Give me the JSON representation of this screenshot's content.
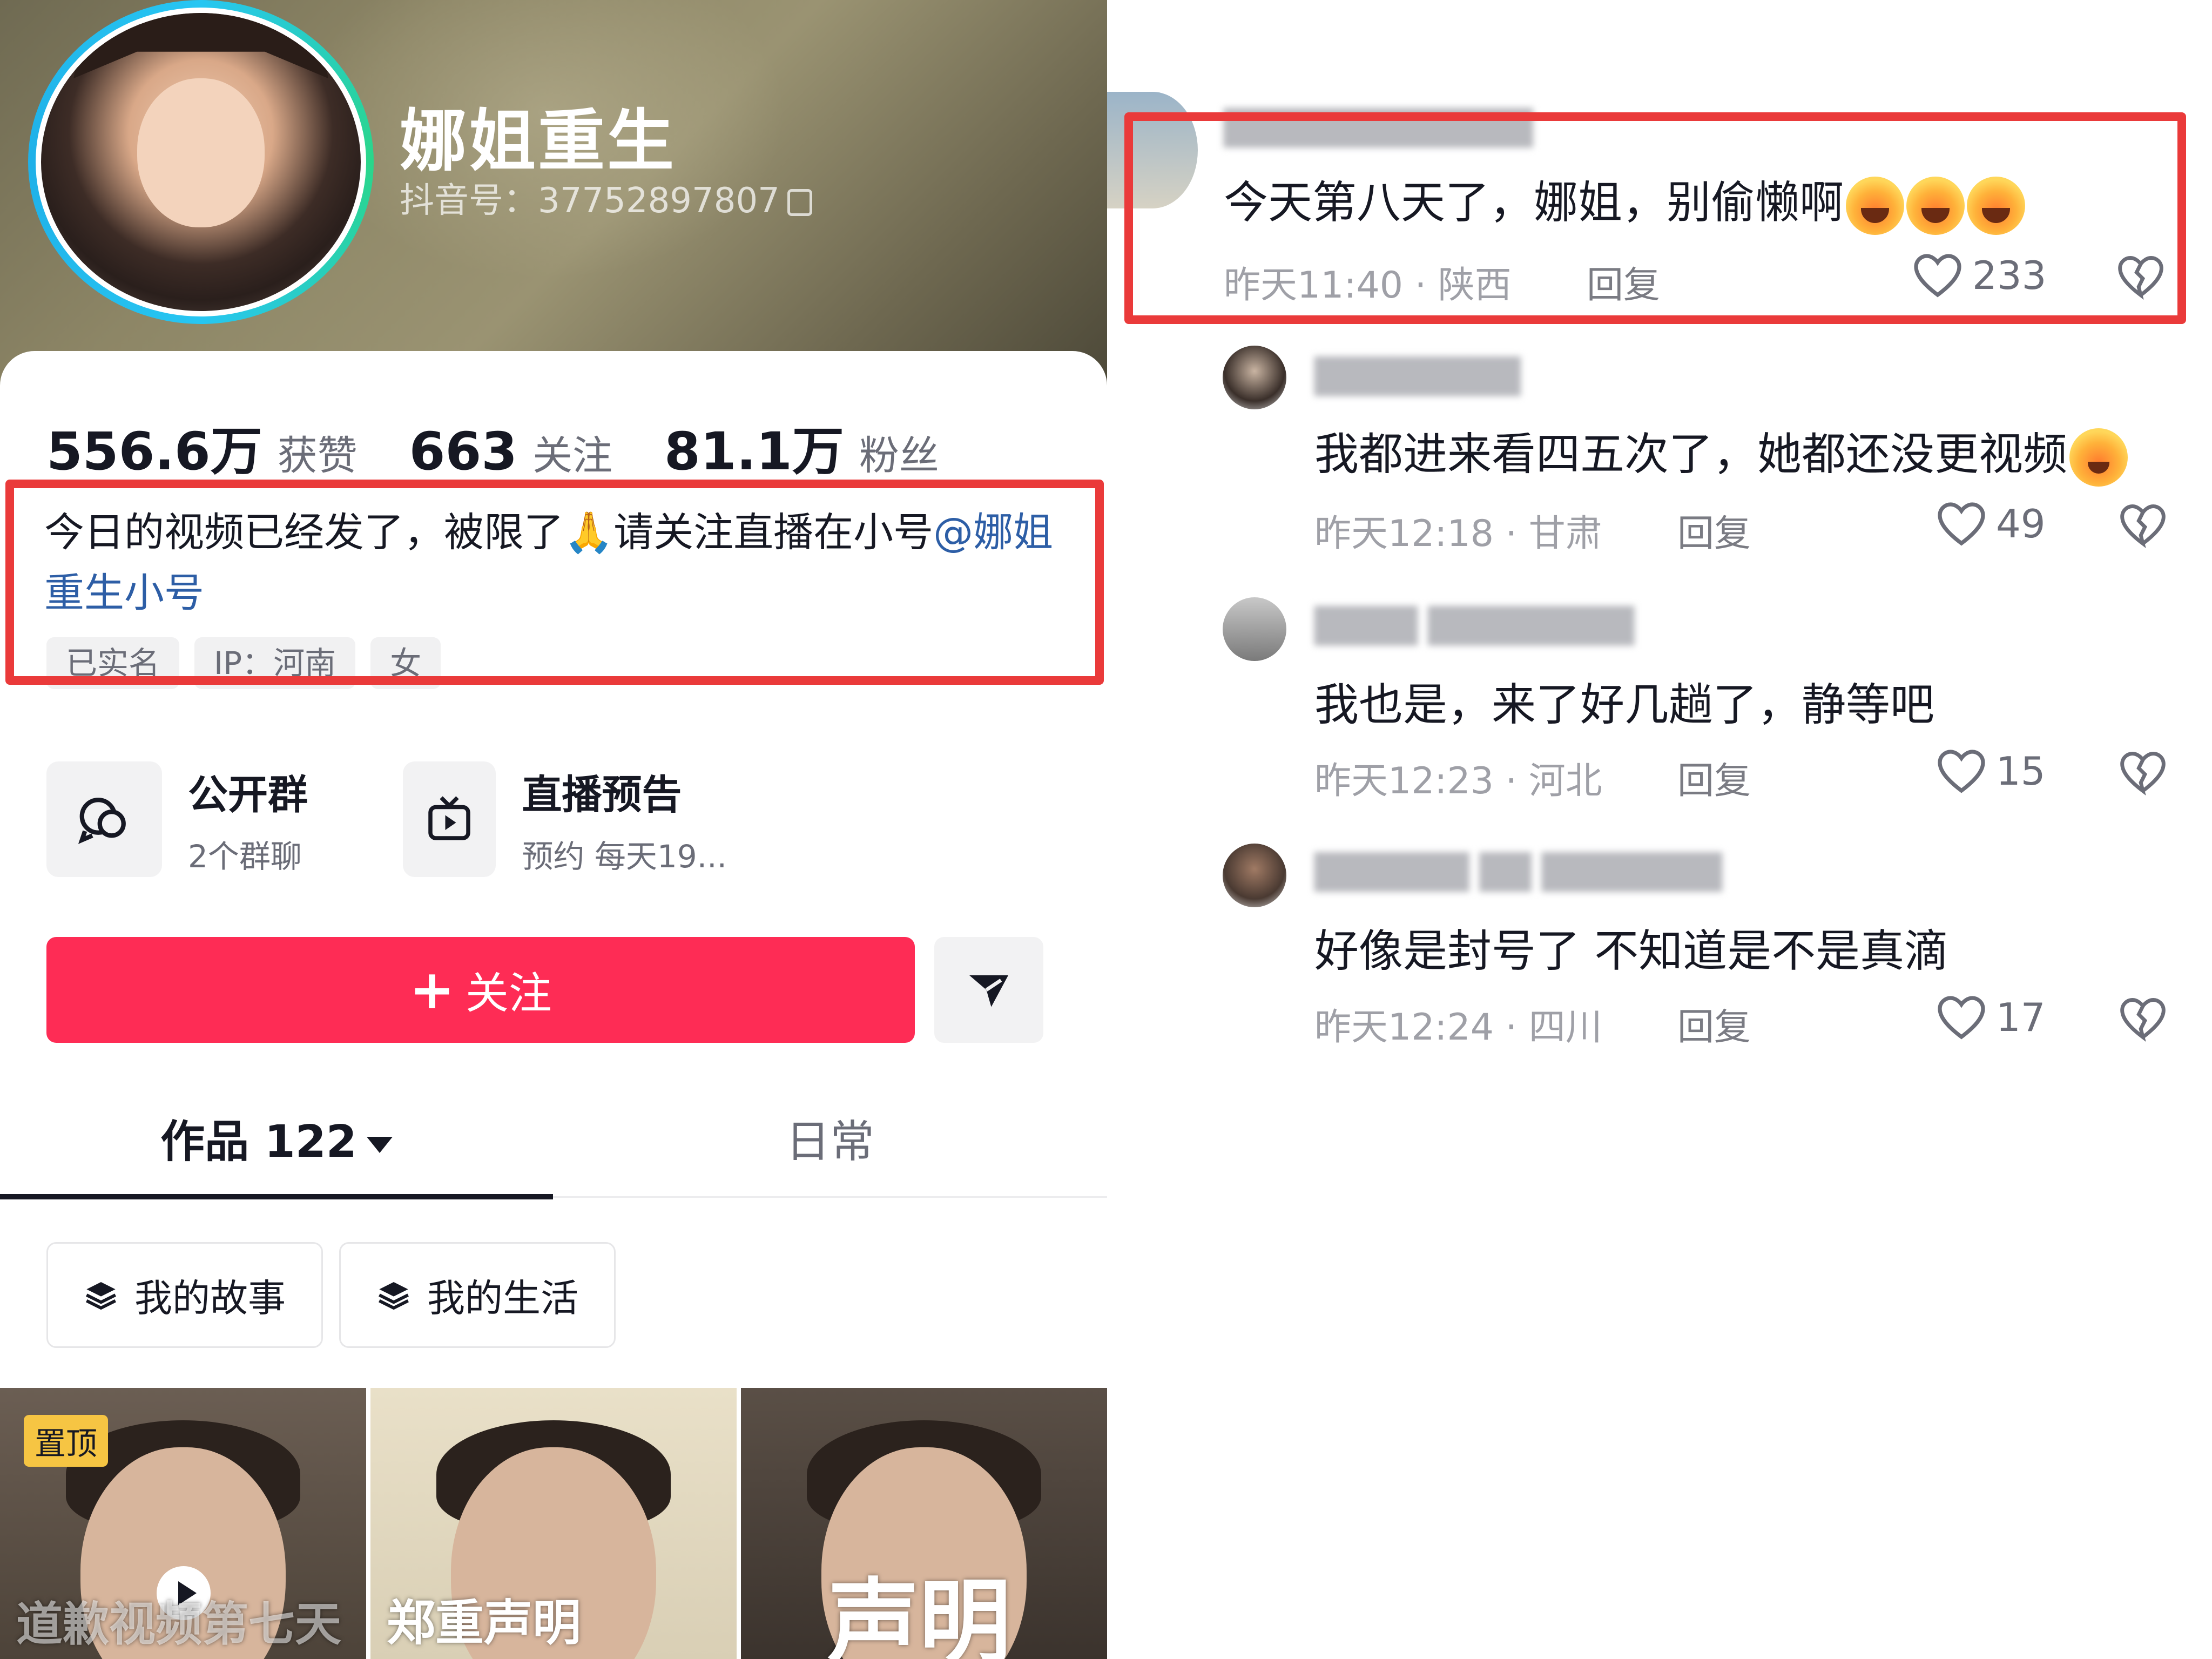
{
  "profile": {
    "nickname": "娜姐重生",
    "douyin_id": "抖音号：37752897807",
    "stats": [
      {
        "value": "556.6万",
        "label": "获赞"
      },
      {
        "value": "663",
        "label": "关注"
      },
      {
        "value": "81.1万",
        "label": "粉丝"
      }
    ],
    "bio_text": "今日的视频已经发了，被限了🙏请关注直播在小号",
    "bio_mention": "@娜姐重生小号",
    "tags": [
      "已实名",
      "IP：河南",
      "女"
    ],
    "shortcuts": [
      {
        "title": "公开群",
        "subtitle": "2个群聊",
        "icon": "group-chat-icon"
      },
      {
        "title": "直播预告",
        "subtitle": "预约 每天19...",
        "icon": "live-tv-icon"
      }
    ],
    "follow_label": "关注",
    "tabs": [
      {
        "label": "作品 122"
      },
      {
        "label": "日常"
      }
    ],
    "collections": [
      {
        "label": "我的故事",
        "icon": "stack-icon"
      },
      {
        "label": "我的生活",
        "icon": "stack-icon"
      }
    ],
    "videos": [
      {
        "badge": "置顶",
        "caption": "道歉视频第七天"
      },
      {
        "caption": "郑重声明"
      },
      {
        "caption": "声明"
      }
    ],
    "colors": {
      "follow": "#fe2c55",
      "highlight": "#ea3a3a",
      "mention": "#2d5ea6"
    }
  },
  "comments": [
    {
      "text": "今天第八天了，娜姐，别偷懒啊",
      "time": "昨天11:40 · 陕西",
      "reply": "回复",
      "likes": "233",
      "emoji": "rolling-laugh-emoji",
      "emoji_count": 3
    },
    {
      "text": "我都进来看四五次了，她都还没更视频",
      "time": "昨天12:18 · 甘肃",
      "reply": "回复",
      "likes": "49",
      "emoji": "crying-emoji",
      "emoji_count": 1
    },
    {
      "text": "我也是，来了好几趟了，静等吧",
      "time": "昨天12:23 · 河北",
      "reply": "回复",
      "likes": "15"
    },
    {
      "text": "好像是封号了 不知道是不是真滴",
      "time": "昨天12:24 · 四川",
      "reply": "回复",
      "likes": "17"
    }
  ]
}
